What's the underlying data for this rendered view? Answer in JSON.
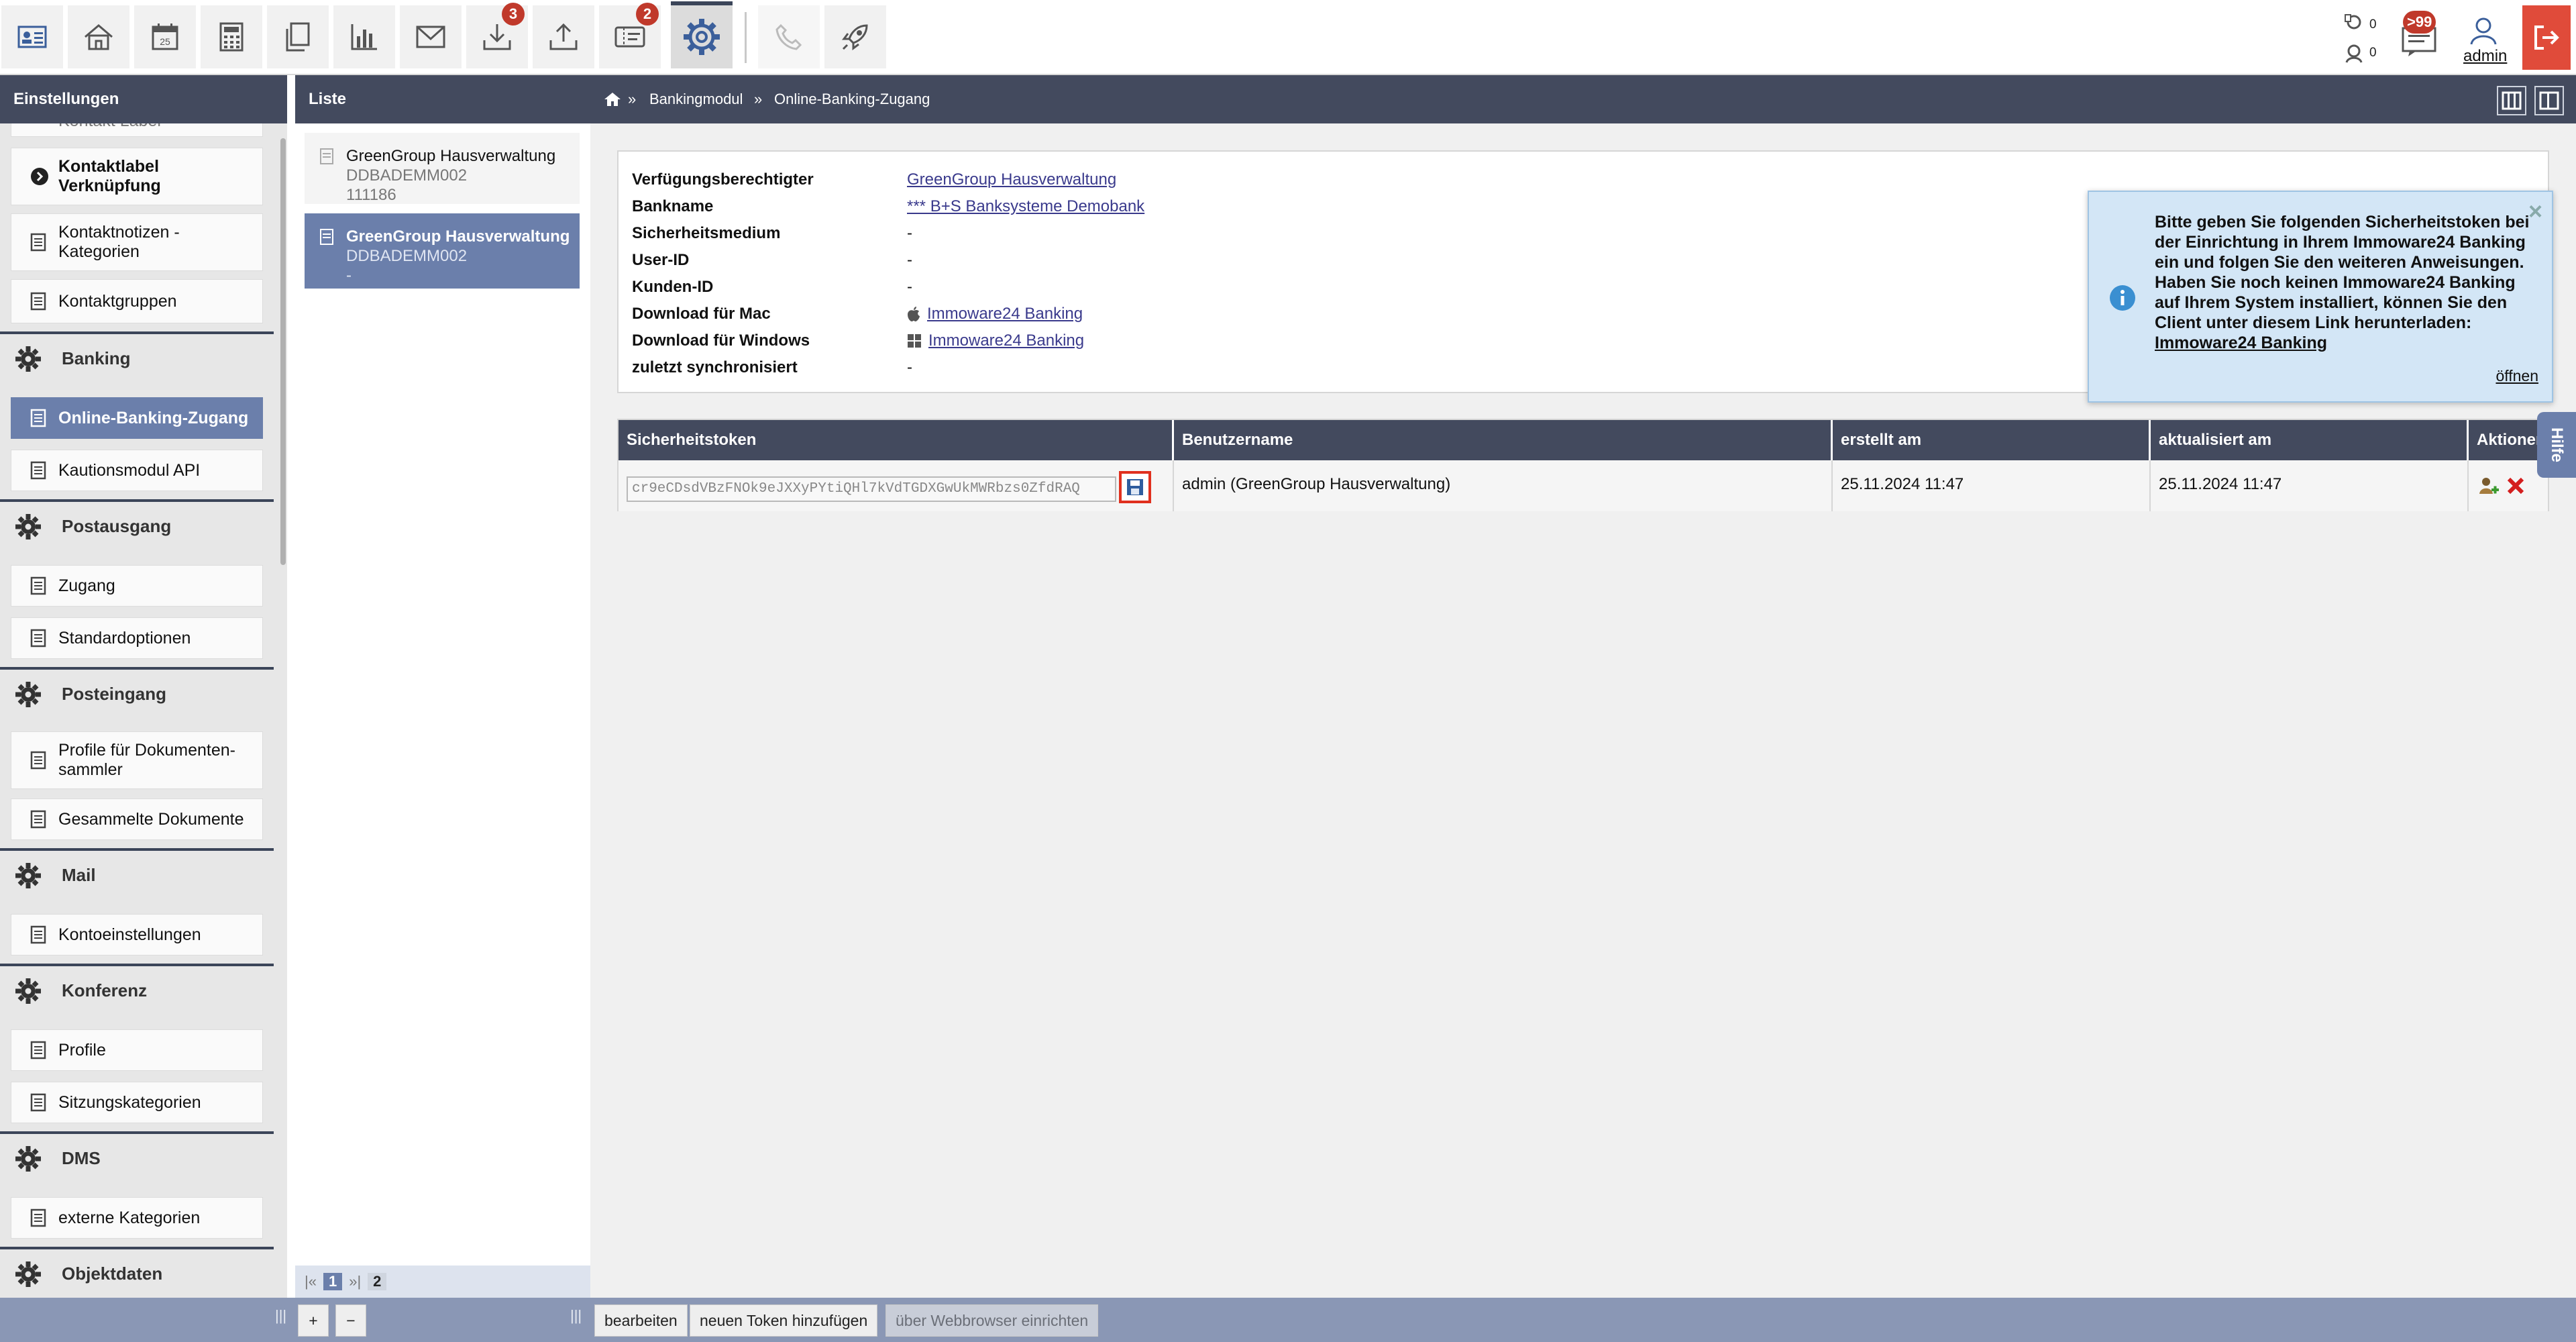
{
  "toolbar": {
    "buttons": [
      {
        "icon": "address-card-icon"
      },
      {
        "icon": "home-icon"
      },
      {
        "icon": "calendar-icon",
        "label": "25"
      },
      {
        "icon": "calculator-icon"
      },
      {
        "icon": "documents-icon"
      },
      {
        "icon": "bar-chart-icon"
      },
      {
        "icon": "mail-icon"
      },
      {
        "icon": "inbox-download-icon",
        "badge": "3"
      },
      {
        "icon": "outbox-upload-icon"
      },
      {
        "icon": "ticket-icon",
        "badge": "2"
      },
      {
        "icon": "gear-icon",
        "active": true
      },
      {
        "icon": "phone-icon",
        "disabled": true
      },
      {
        "icon": "rocket-icon"
      }
    ],
    "counter_1": "0",
    "counter_2": "0",
    "messages_badge": ">99",
    "user": "admin"
  },
  "headers": {
    "settings": "Einstellungen",
    "list": "Liste",
    "breadcrumb": [
      "Bankingmodul",
      "Online-Banking-Zugang"
    ],
    "breadcrumb_sep": "»"
  },
  "sidebar": {
    "cut_item": "Kontakt Label",
    "items_top": [
      {
        "label": "Kontaktlabel Verknüpfung",
        "bold": true
      },
      {
        "label": "Kontaktnotizen - Kategorien"
      },
      {
        "label": "Kontaktgruppen"
      }
    ],
    "sections": [
      {
        "title": "Banking",
        "items": [
          "Online-Banking-Zugang",
          "Kautionsmodul API"
        ]
      },
      {
        "title": "Postausgang",
        "items": [
          "Zugang",
          "Standardoptionen"
        ]
      },
      {
        "title": "Posteingang",
        "items": [
          "Profile für Dokumenten-sammler",
          "Gesammelte Dokumente"
        ]
      },
      {
        "title": "Mail",
        "items": [
          "Kontoeinstellungen"
        ]
      },
      {
        "title": "Konferenz",
        "items": [
          "Profile",
          "Sitzungskategorien"
        ]
      },
      {
        "title": "DMS",
        "items": [
          "externe Kategorien"
        ]
      },
      {
        "title": "Objektdaten",
        "items": []
      }
    ],
    "selected": "Online-Banking-Zugang"
  },
  "list": {
    "items": [
      {
        "title": "GreenGroup Hausverwaltung",
        "line2": "DDBADEMM002",
        "line3": "111186"
      },
      {
        "title": "GreenGroup Hausverwaltung",
        "line2": "DDBADEMM002",
        "line3": "-",
        "selected": true
      }
    ],
    "pager": {
      "first": "|«",
      "current": "1",
      "last": "»|",
      "next": "2"
    }
  },
  "details": {
    "rows": [
      {
        "label": "Verfügungsberechtigter",
        "value": "GreenGroup Hausverwaltung",
        "link": true
      },
      {
        "label": "Bankname",
        "value": "*** B+S Banksysteme Demobank",
        "link": true
      },
      {
        "label": "Sicherheitsmedium",
        "value": "-"
      },
      {
        "label": "User-ID",
        "value": "-"
      },
      {
        "label": "Kunden-ID",
        "value": "-"
      },
      {
        "label": "Download für Mac",
        "value": "Immoware24 Banking",
        "link": true,
        "icon": "apple-icon"
      },
      {
        "label": "Download für Windows",
        "value": "Immoware24 Banking",
        "link": true,
        "icon": "windows-icon"
      },
      {
        "label": "zuletzt synchronisiert",
        "value": "-"
      }
    ]
  },
  "token_table": {
    "headers": [
      "Sicherheitstoken",
      "Benutzername",
      "erstellt am",
      "aktualisiert am",
      "Aktionen"
    ],
    "row": {
      "token": "cr9eCDsdVBzFNOk9eJXXyPYtiQHl7kVdTGDXGwUkMWRbzs0ZfdRAQ",
      "username": "admin (GreenGroup Hausverwaltung)",
      "created": "25.11.2024 11:47",
      "updated": "25.11.2024 11:47"
    }
  },
  "popup": {
    "text_1": "Bitte geben Sie folgenden Sicherheitstoken bei der Einrichtung in Ihrem Immoware24 Banking ein und folgen Sie den weiteren Anweisungen.",
    "text_2": "Haben Sie noch keinen Immoware24 Banking auf Ihrem System installiert, können Sie den Client unter diesem Link herunterladen: ",
    "link": "Immoware24 Banking",
    "open": "öffnen",
    "close": "×"
  },
  "help_tab": "Hilfe",
  "footer": {
    "add": "+",
    "remove": "−",
    "edit": "bearbeiten",
    "new_token": "neuen Token hinzufügen",
    "browser_setup": "über Webbrowser einrichten",
    "grip": "|||"
  },
  "colors": {
    "header": "#434a5e",
    "selected": "#6b7fab",
    "badge": "#c0392b",
    "logout": "#e04b3a",
    "popup": "#d3e6f6"
  }
}
